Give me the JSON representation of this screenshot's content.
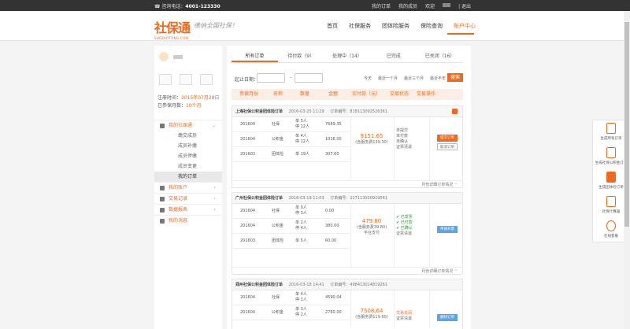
{
  "topbar": {
    "phone_label": "咨询电话：",
    "phone": "4001-123330",
    "my_orders": "我的订单",
    "my_members": "我的成员",
    "welcome": "欢迎",
    "logout": "| 退出"
  },
  "logo": {
    "cn": "社保通",
    "en": "SHEBAOTONG.COM",
    "slogan": "缴纳全国社保！"
  },
  "nav": [
    "首页",
    "社保服务",
    "团体险服务",
    "保险查询",
    "账户中心"
  ],
  "sidebar": {
    "reg_label": "注册时间：",
    "reg_date": "2015年07月28日",
    "months_label": "已参保月数：",
    "months": "10个月",
    "menu": [
      {
        "label": "我的社保通",
        "chevron": "⌄",
        "subs": [
          "缴交成员",
          "成员补缴",
          "成员停缴",
          "成员变更",
          "我的订单"
        ]
      },
      {
        "label": "我的账户",
        "chevron": "›"
      },
      {
        "label": "交易记录",
        "chevron": "›"
      },
      {
        "label": "数据报表",
        "chevron": "›"
      },
      {
        "label": "我的消息",
        "chevron": ""
      }
    ]
  },
  "tabs": [
    "所有订单",
    "待付款（9）",
    "处理中（14）",
    "已完成",
    "已关闭（16）"
  ],
  "filter": {
    "label": "起止日期：",
    "dash": "-",
    "options": [
      "今天",
      "最近一个月",
      "最近三个月",
      "最近半年"
    ],
    "search": "搜索"
  },
  "table_headers": [
    "参保月份",
    "名称",
    "数量",
    "金额",
    "实付款（元）",
    "交易状态",
    "交易操作"
  ],
  "orders": [
    {
      "city": "上海社保公积金团体险订单",
      "time": "2016-03-25 11:29",
      "no_label": "订单编号：",
      "no": "818113092526361",
      "rows": [
        {
          "month": "201604",
          "name": "社保",
          "q1": "单 5人",
          "q2": "停 12人",
          "amount": "7689.35"
        },
        {
          "month": "201604",
          "name": "公积金",
          "q1": "单 4人",
          "q2": "停 12人",
          "amount": "1016.00"
        },
        {
          "month": "201603",
          "name": "团体险",
          "q1": "单 19人",
          "q2": "",
          "amount": "307.00"
        }
      ],
      "paid": "9151.65",
      "fee": "(含服务费139.30)",
      "status": [
        "未提交",
        "未付款",
        "未确认",
        "证票清退"
      ],
      "actions": [
        "提交订单",
        "取消订单"
      ],
      "footer": "月份详细订单情况"
    },
    {
      "city": "广州社保公积金团体险订单",
      "time": "2016-03-19 11:03",
      "no_label": "订单编号：",
      "no": "227113020919561",
      "rows": [
        {
          "month": "201604",
          "name": "社保",
          "q1": "单 0人",
          "q2": "停 3人",
          "amount": "0.00"
        },
        {
          "month": "201604",
          "name": "公积金",
          "q1": "单 2人",
          "q2": "停 4人",
          "amount": "380.00"
        },
        {
          "month": "201603",
          "name": "团体险",
          "q1": "单 5人",
          "q2": "",
          "amount": "60.00"
        }
      ],
      "paid": "479.80",
      "fee": "(含服务费39.80)",
      "extra": "平台支付",
      "status": [
        "已发票",
        "已付款",
        "已确认",
        "证票清退"
      ],
      "actions": [
        "申请开票"
      ],
      "footer": "月份详细订单情况"
    },
    {
      "city": "郑州社保公积金团体险订单",
      "time": "2016-03-18 14:41",
      "no_label": "订单编号：",
      "no": "498413014819261",
      "rows": [
        {
          "month": "201604",
          "name": "社保",
          "q1": "单 4人",
          "q2": "停 1人",
          "amount": "4590.04"
        },
        {
          "month": "201604",
          "name": "公积金",
          "q1": "单 3人",
          "q2": "停 2人",
          "amount": "2760.00"
        }
      ],
      "paid": "7508.64",
      "fee": "(含服务费119.60)",
      "status": [
        "交易关闭",
        "证票清退"
      ],
      "actions": [
        "删除订单"
      ]
    }
  ],
  "right_panel": [
    "生成所有订单",
    "生成社保公积金订单",
    "生成团体险订单",
    "社保计算器",
    "在线客服"
  ]
}
